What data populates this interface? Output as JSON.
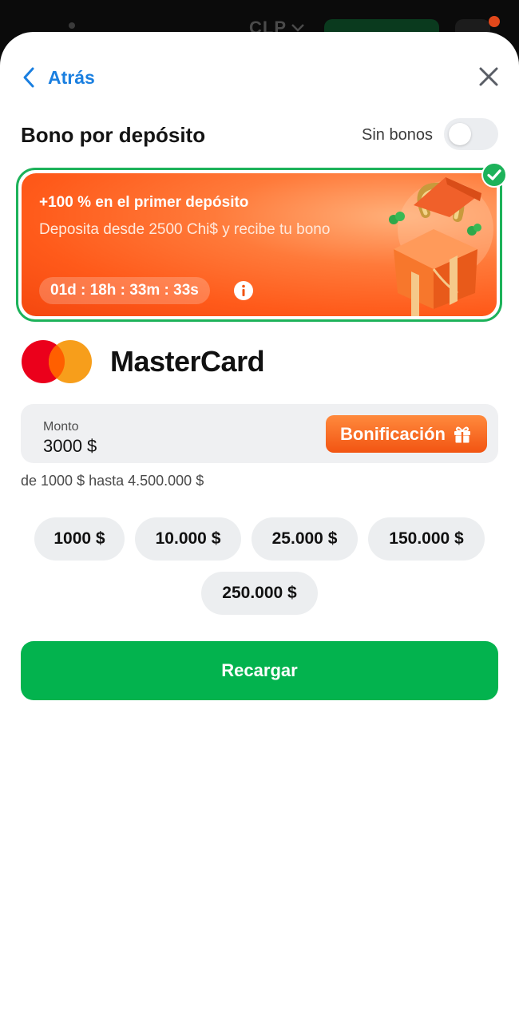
{
  "background": {
    "currency": "CLP"
  },
  "header": {
    "back_label": "Atrás"
  },
  "bonus_section": {
    "title": "Bono por depósito",
    "no_bonus_label": "Sin bonos",
    "no_bonus_enabled": false
  },
  "bonus_card": {
    "title": "+100 % en el primer depósito",
    "subtitle": "Deposita desde 2500 Chi$ y recibe tu bono",
    "timer": "01d : 18h : 33m : 33s",
    "selected": true
  },
  "payment_method": {
    "name": "MasterCard",
    "icon": "mastercard-logo"
  },
  "amount": {
    "label": "Monto",
    "value": "3000 $",
    "bonus_button_label": "Bonificación",
    "range_text": "de 1000 $ hasta 4.500.000 $"
  },
  "quick_amounts": [
    "1000 $",
    "10.000 $",
    "25.000 $",
    "150.000 $",
    "250.000 $"
  ],
  "submit_label": "Recargar",
  "colors": {
    "accent_blue": "#1a7fe0",
    "success_green": "#03b34e",
    "bonus_orange": "#f25412",
    "chip_bg": "#eceef0"
  }
}
